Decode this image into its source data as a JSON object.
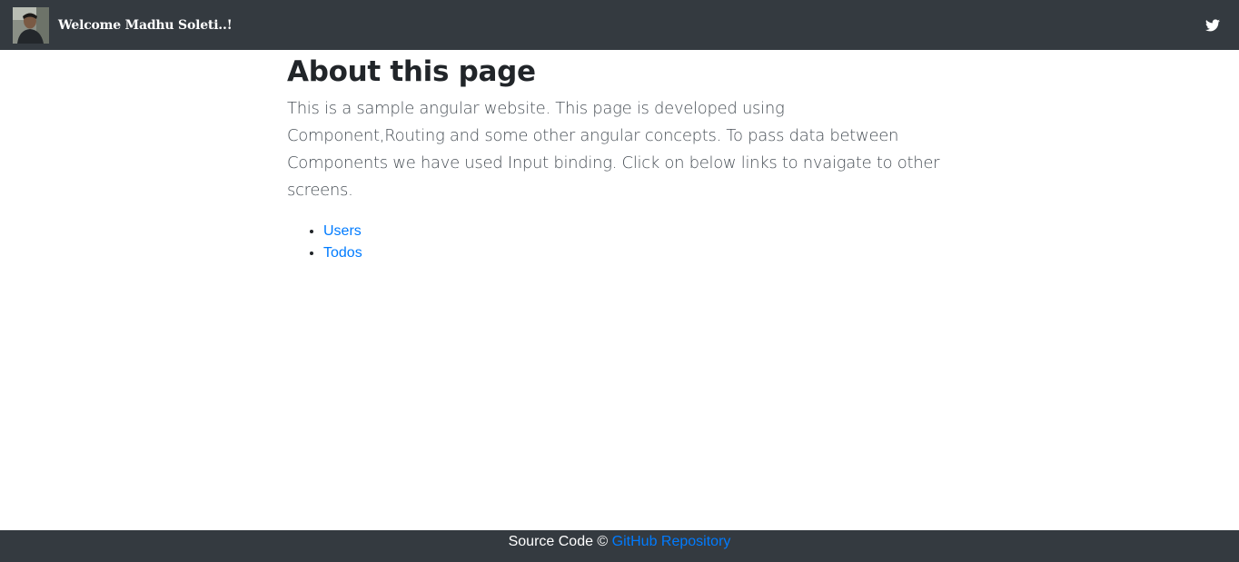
{
  "header": {
    "welcome_text": "Welcome Madhu Soleti..!",
    "avatar_icon": "user-photo",
    "social_icon": "twitter-icon"
  },
  "main": {
    "title": "About this page",
    "description": "This is a sample angular website. This page is developed using Component,Routing and some other angular concepts. To pass data between Components we have used Input binding. Click on below links to nvaigate to other screens.",
    "links": [
      {
        "label": "Users"
      },
      {
        "label": "Todos"
      }
    ]
  },
  "footer": {
    "prefix": "Source Code © ",
    "link_label": "GitHub Repository"
  },
  "colors": {
    "navbar_bg": "#343a40",
    "link": "#007bff",
    "text": "#212529",
    "lead": "#495057"
  }
}
